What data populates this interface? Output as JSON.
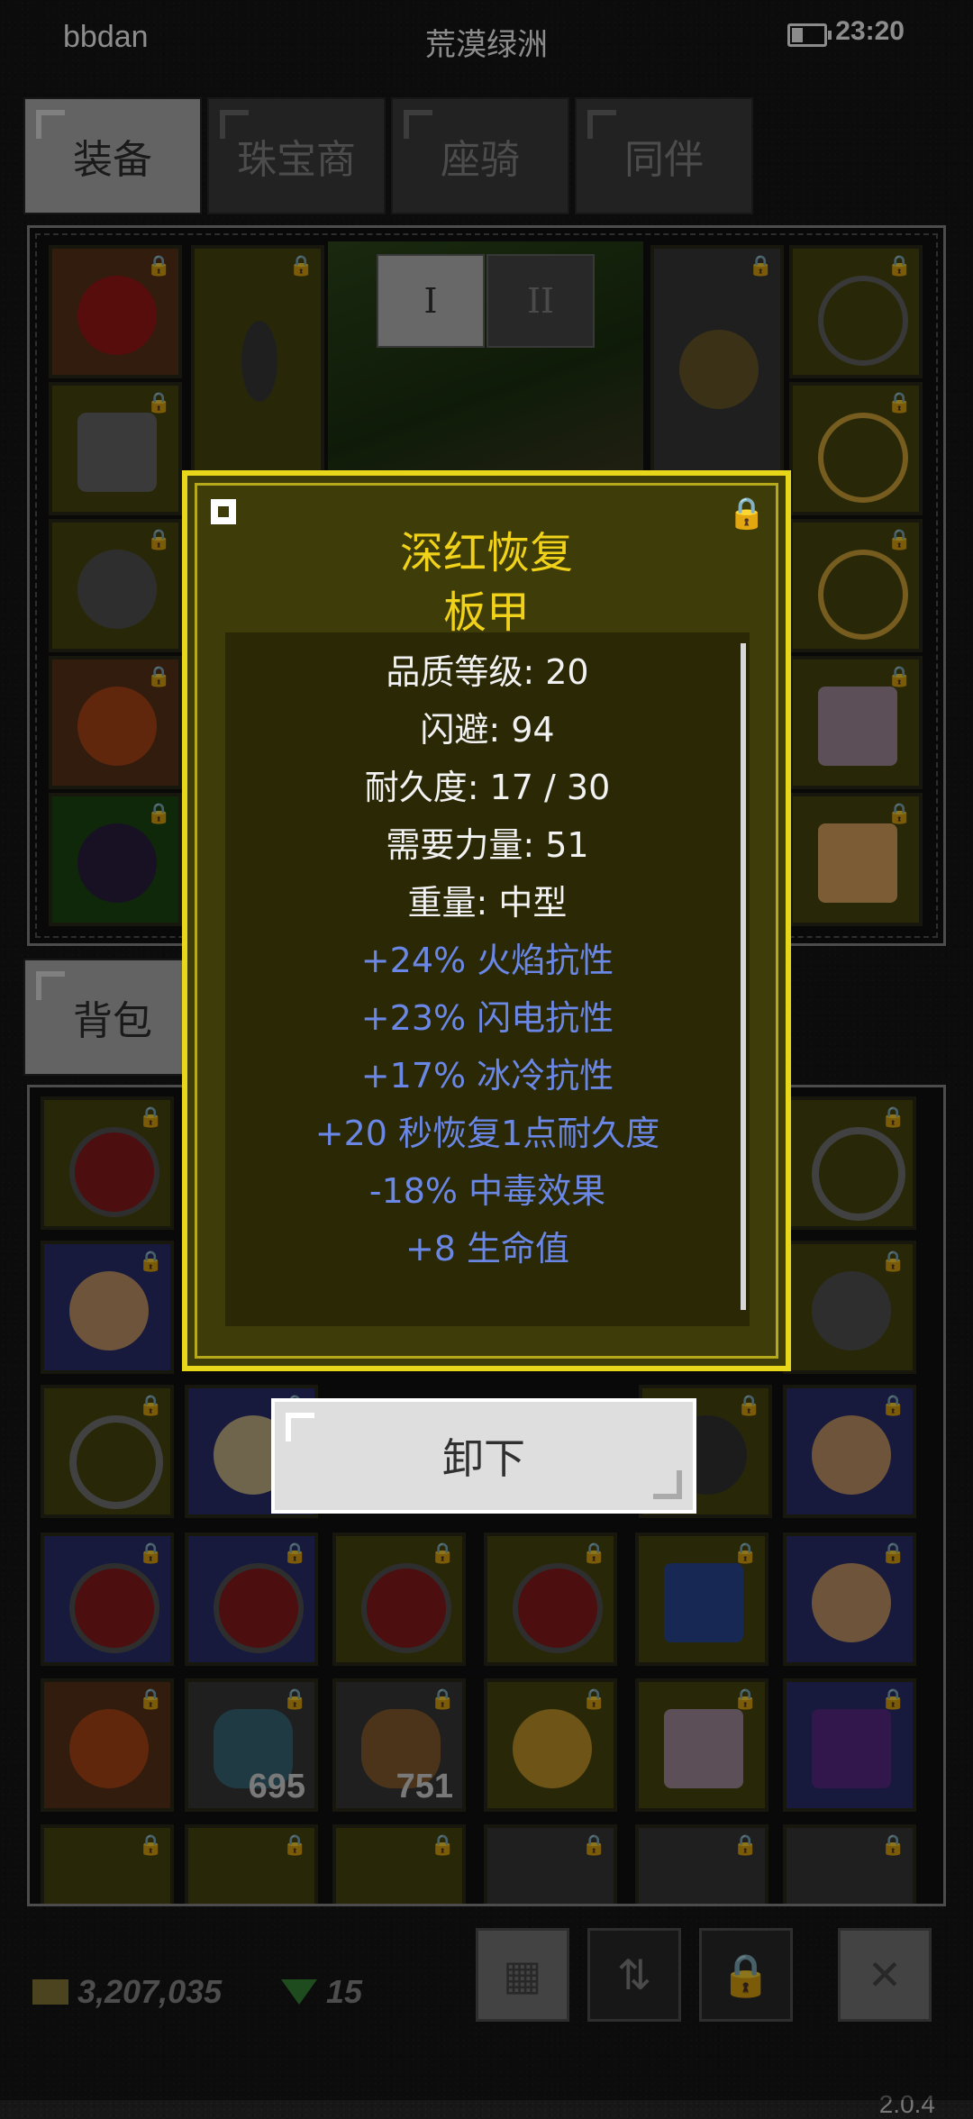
{
  "status_bar": {
    "user": "bbdan",
    "title": "荒漠绿洲",
    "time": "23:20",
    "battery_icon": "battery-icon"
  },
  "tabs": [
    {
      "label": "装备",
      "active": true
    },
    {
      "label": "珠宝商",
      "active": false
    },
    {
      "label": "座骑",
      "active": false
    },
    {
      "label": "同伴",
      "active": false
    }
  ],
  "equip_row_buttons": [
    "I",
    "II"
  ],
  "backpack_tab": "背包",
  "tooltip": {
    "item_name": "深红恢复",
    "item_type": "板甲",
    "stats": [
      "品质等级: 20",
      "闪避: 94",
      "耐久度: 17 / 30",
      "需要力量: 51",
      "重量: 中型"
    ],
    "mods": [
      "+24% 火焰抗性",
      "+23% 闪电抗性",
      "+17% 冰冷抗性",
      "+20 秒恢复1点耐久度",
      "-18% 中毒效果",
      "+8 生命值"
    ],
    "colors": {
      "name": "#f0d21a",
      "mods": "#6a87e6",
      "border": "#e8d61a"
    }
  },
  "unequip_button": "卸下",
  "inventory_quantities": [
    "695",
    "751"
  ],
  "bottom_bar": {
    "gold": "3,207,035",
    "gems": "15",
    "buttons": [
      "grid-icon",
      "sort-icon",
      "lock-icon",
      "close-icon"
    ]
  },
  "version": "2.0.4"
}
